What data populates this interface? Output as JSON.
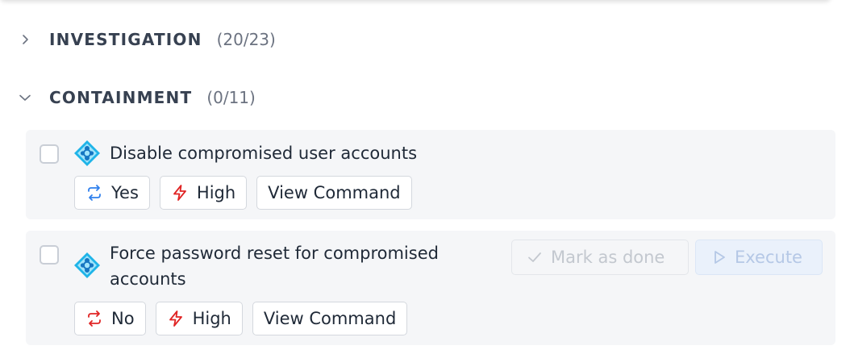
{
  "sections": [
    {
      "title": "INVESTIGATION",
      "count": "(20/23)",
      "expanded": false
    },
    {
      "title": "CONTAINMENT",
      "count": "(0/11)",
      "expanded": true
    }
  ],
  "tasks": [
    {
      "title": "Disable compromised user accounts",
      "automated": {
        "label": "Yes",
        "color": "#2f80ed"
      },
      "priority": {
        "label": "High",
        "color": "#e02424"
      },
      "view_command_label": "View Command"
    },
    {
      "title": "Force password reset for compromised accounts",
      "automated": {
        "label": "No",
        "color": "#e02424"
      },
      "priority": {
        "label": "High",
        "color": "#e02424"
      },
      "view_command_label": "View Command",
      "mark_done_label": "Mark as done",
      "execute_label": "Execute"
    }
  ],
  "icon_names": {
    "collapsed": "chevron-right-icon",
    "expanded": "chevron-down-icon",
    "task": "azure-ad-icon",
    "automation": "repeat-icon",
    "priority": "lightning-icon"
  }
}
